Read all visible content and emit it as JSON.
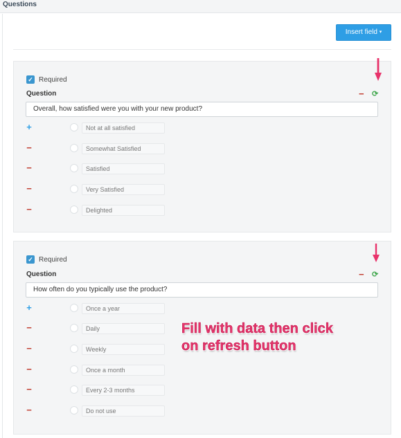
{
  "panel": {
    "title": "Questions",
    "insert_button_label": "Insert field",
    "insert_button_caret": "▾"
  },
  "icons": {
    "checkbox_checked": "checkbox-checked-icon",
    "minus": "minus-icon",
    "refresh": "refresh-icon",
    "plus": "plus-icon",
    "arrow_down": "arrow-down-icon"
  },
  "colors": {
    "accent": "#2e9ee5",
    "remove": "#c0392b",
    "refresh": "#3ea64b",
    "annotation": "#e8336b"
  },
  "questions": [
    {
      "required_label": "Required",
      "question_label": "Question",
      "question_text": "Overall, how satisfied were you with your new product?",
      "options": [
        {
          "sign": "+",
          "label": "Not at all satisfied"
        },
        {
          "sign": "−",
          "label": "Somewhat Satisfied"
        },
        {
          "sign": "−",
          "label": "Satisfied"
        },
        {
          "sign": "−",
          "label": "Very Satisfied"
        },
        {
          "sign": "−",
          "label": "Delighted"
        }
      ]
    },
    {
      "required_label": "Required",
      "question_label": "Question",
      "question_text": "How often do you typically use the product?",
      "options": [
        {
          "sign": "+",
          "label": "Once a year"
        },
        {
          "sign": "−",
          "label": "Daily"
        },
        {
          "sign": "−",
          "label": "Weekly"
        },
        {
          "sign": "−",
          "label": "Once a month"
        },
        {
          "sign": "−",
          "label": "Every 2-3 months"
        },
        {
          "sign": "−",
          "label": "Do not use"
        }
      ]
    }
  ],
  "annotation": {
    "line1": "Fill with data then click",
    "line2": "on refresh button"
  }
}
